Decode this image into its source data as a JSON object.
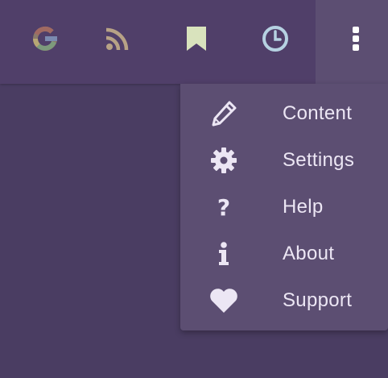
{
  "toolbar": {
    "buttons": [
      {
        "name": "google-search",
        "icon": "google-icon"
      },
      {
        "name": "rss-feed",
        "icon": "rss-icon",
        "color": "#b7a286"
      },
      {
        "name": "bookmarks",
        "icon": "bookmark-icon",
        "color": "#d9e3bd"
      },
      {
        "name": "history",
        "icon": "clock-icon",
        "color": "#b6d2e2"
      }
    ],
    "more_icon": "more-vertical-icon"
  },
  "menu": {
    "items": [
      {
        "label": "Content",
        "icon": "pencil-icon"
      },
      {
        "label": "Settings",
        "icon": "gear-icon"
      },
      {
        "label": "Help",
        "icon": "question-icon"
      },
      {
        "label": "About",
        "icon": "info-icon"
      },
      {
        "label": "Support",
        "icon": "heart-icon"
      }
    ]
  },
  "colors": {
    "background": "#4a3d62",
    "toolbar": "#503f69",
    "menu": "#5c4e72",
    "menu_text": "#ece6f4"
  }
}
